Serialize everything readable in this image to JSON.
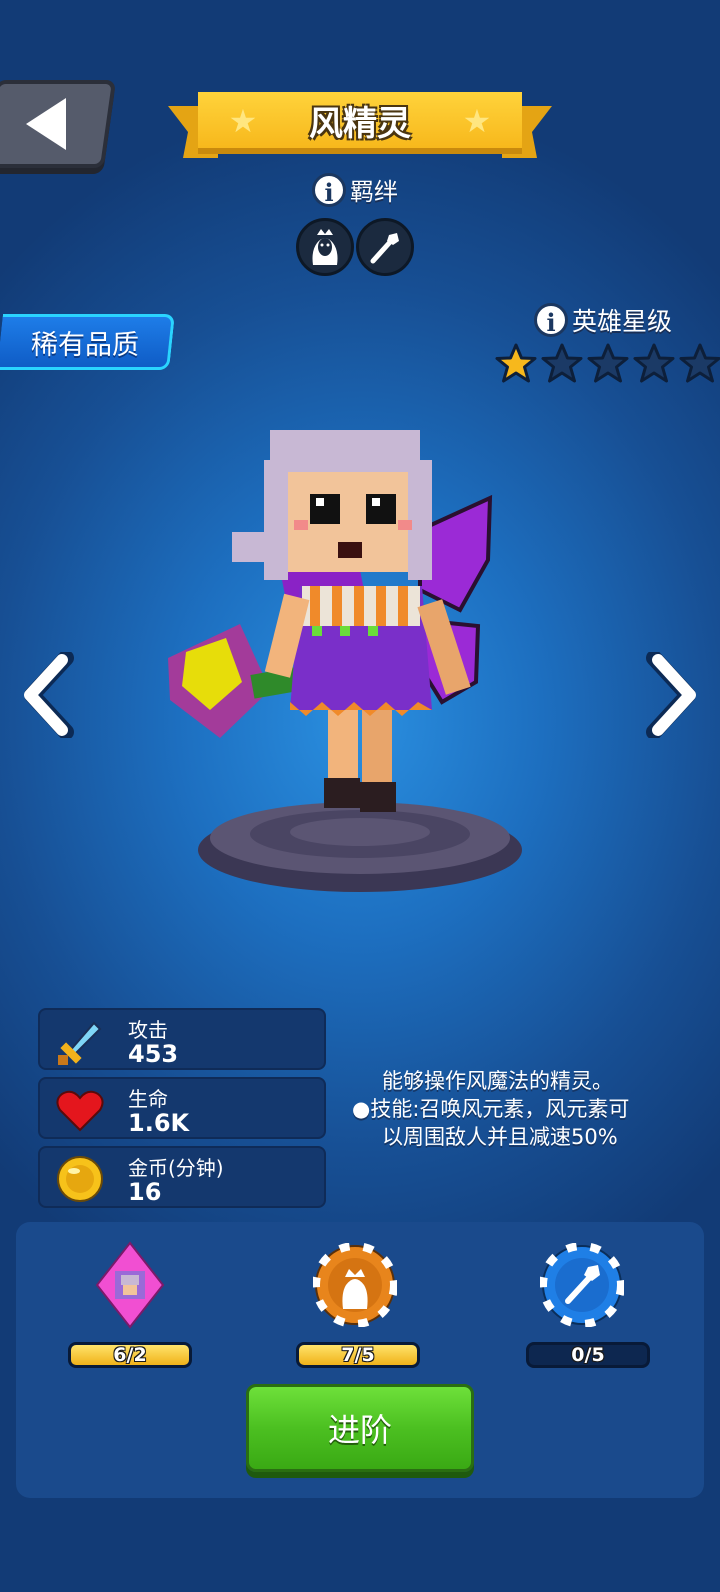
{
  "header": {
    "back_icon": "back-arrow-icon",
    "title": "风精灵",
    "bond_label": "羁绊",
    "bond_icons": [
      "elf-portrait-icon",
      "wand-icon"
    ]
  },
  "rarity_label": "稀有品质",
  "star_level": {
    "label": "英雄星级",
    "filled": 1,
    "total": 5
  },
  "stats": [
    {
      "label": "攻击",
      "value": "453",
      "icon": "sword-icon"
    },
    {
      "label": "生命",
      "value": "1.6K",
      "icon": "heart-icon"
    },
    {
      "label": "金币(分钟)",
      "value": "16",
      "icon": "gold-coin-icon"
    }
  ],
  "description": {
    "line1": "能够操作风魔法的精灵。",
    "line2": "●技能:召唤风元素，风元素可",
    "line3": "以周围敌人并且减速50%"
  },
  "materials": [
    {
      "icon": "hero-card-gem-icon",
      "progress_text": "6/2",
      "fraction": 1.0
    },
    {
      "icon": "elf-token-icon",
      "progress_text": "7/5",
      "fraction": 1.0
    },
    {
      "icon": "wand-token-icon",
      "progress_text": "0/5",
      "fraction": 0.0
    }
  ],
  "advance_button": "进阶",
  "colors": {
    "banner": "#f7b81c",
    "rarity": "#1e7de8",
    "advance": "#4cc021",
    "progress_fill": "#f0b21a"
  }
}
